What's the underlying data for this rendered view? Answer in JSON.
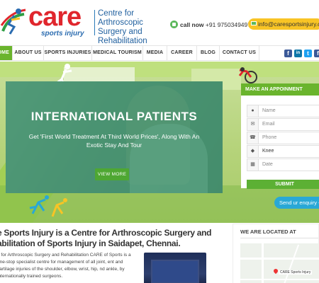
{
  "header": {
    "logo_word": "care",
    "logo_tagline": "sports injury",
    "logo_title": "Centre for Arthroscopic Surgery and Rehabilitation",
    "call_label": "call now",
    "call_number": "+91 9750349497",
    "email": "info@caresportsinjury.co"
  },
  "nav": {
    "items": [
      {
        "label": "HOME"
      },
      {
        "label": "ABOUT US"
      },
      {
        "label": "SPORTS INJURIES"
      },
      {
        "label": "MEDICAL TOURISM"
      },
      {
        "label": "MEDIA"
      },
      {
        "label": "CAREER"
      },
      {
        "label": "BLOG"
      },
      {
        "label": "CONTACT US"
      }
    ],
    "social": [
      {
        "icon": "facebook-icon",
        "glyph": "f",
        "color": "#3b5998"
      },
      {
        "icon": "linkedin-icon",
        "glyph": "in",
        "color": "#0e76a8"
      },
      {
        "icon": "twitter-icon",
        "glyph": "t",
        "color": "#1da1f2"
      },
      {
        "icon": "facebook-icon",
        "glyph": "f",
        "color": "#3b5998"
      }
    ]
  },
  "slide": {
    "title": "INTERNATIONAL PATIENTS",
    "subtitle": "Get 'First World Treatment At Third World Prices', Along With An Exotic Stay And Tour",
    "button": "VIEW MORE"
  },
  "appointment": {
    "title": "MAKE AN APPOINMENT",
    "fields": [
      {
        "icon": "user-icon",
        "glyph": "👤",
        "placeholder": "Name"
      },
      {
        "icon": "mail-icon",
        "glyph": "✉",
        "placeholder": "Email"
      },
      {
        "icon": "phone-icon",
        "glyph": "📱",
        "placeholder": "Phone"
      },
      {
        "icon": "tag-icon",
        "glyph": "🏷",
        "value": "Knee"
      },
      {
        "icon": "calendar-icon",
        "glyph": "📅",
        "placeholder": "Date"
      }
    ],
    "submit": "SUBMIT"
  },
  "enquiry": "Send ur enquiry -",
  "intro": {
    "heading": "e Sports Injury is a Centre for Arthroscopic Surgery and abilitation of Sports Injury in Saidapet, Chennai.",
    "body": "e for Arthroscopic Surgery and Rehabilitation CARE of Sports is a one-stop specialist centre for management of all joint, ent and cartilage injuries of the shoulder, elbow, wrist, hip, nd ankle, by internationally trained surgeons."
  },
  "location": {
    "heading": "WE ARE LOCATED AT",
    "pin_label": "CARE Sports Injury"
  },
  "colors": {
    "brand_green": "#6ab42d",
    "brand_red": "#e0262d",
    "accent_yellow": "#f8c425",
    "enquiry_blue": "#29a8d6"
  }
}
